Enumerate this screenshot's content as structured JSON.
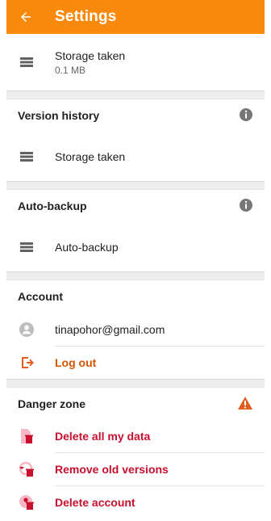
{
  "appbar": {
    "title": "Settings",
    "back_icon": "arrow-left-icon",
    "color": "#f7890d"
  },
  "storage": {
    "label": "Storage taken",
    "value": "0.1 MB"
  },
  "version_history": {
    "title": "Version history",
    "item_label": "Storage taken"
  },
  "auto_backup": {
    "title": "Auto-backup",
    "item_label": "Auto-backup"
  },
  "account": {
    "title": "Account",
    "email": "tinapohor@gmail.com",
    "logout_label": "Log out"
  },
  "danger_zone": {
    "title": "Danger zone",
    "items": [
      {
        "label": "Delete all my data",
        "icon": "delete-data-icon"
      },
      {
        "label": "Remove old versions",
        "icon": "remove-versions-icon"
      },
      {
        "label": "Delete account",
        "icon": "delete-account-icon"
      }
    ],
    "accent": "#c8102e",
    "warning_color": "#e35d1f"
  }
}
